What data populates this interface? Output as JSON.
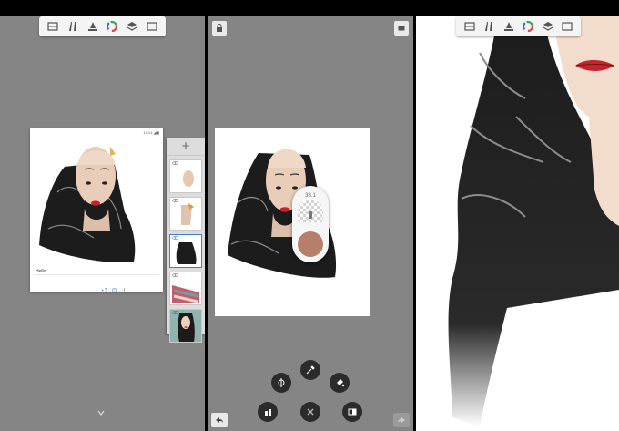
{
  "toolbar": {
    "icons": [
      "layers-grid-icon",
      "brush-icon",
      "ruler-icon",
      "color-wheel-icon",
      "stack-icon",
      "fullscreen-icon"
    ]
  },
  "gallery": {
    "status_text": "10:21 ◢ ▮",
    "caption": "Hello",
    "add_layer_label": "+",
    "layers": [
      {
        "name": "layer-face"
      },
      {
        "name": "layer-neck"
      },
      {
        "name": "layer-bag",
        "active": true
      },
      {
        "name": "layer-photos"
      },
      {
        "name": "layer-portrait"
      }
    ]
  },
  "editor": {
    "opacity_label": "38.1",
    "swatch_color": "#b67f6b",
    "radial_buttons": [
      "symmetry-icon",
      "eyedropper-icon",
      "fill-icon",
      "brush-tool-icon",
      "close-icon",
      "compare-icon"
    ]
  },
  "colors": {
    "panel_gray": "#858585",
    "accent_blue": "#3f7fd9",
    "lip_red": "#c3242e",
    "bag_black": "#1c1c1c"
  }
}
